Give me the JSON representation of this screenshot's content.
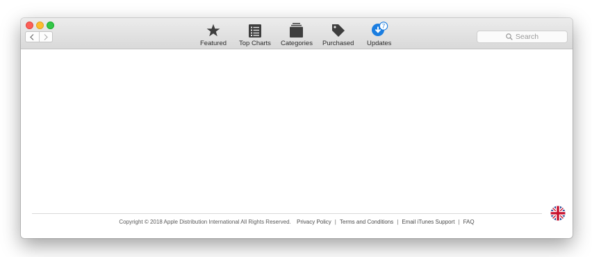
{
  "window": {
    "traffic_lights": [
      "close",
      "minimize",
      "zoom"
    ]
  },
  "toolbar": {
    "nav": {
      "back_icon": "chevron-left-icon",
      "forward_icon": "chevron-right-icon"
    },
    "tabs": [
      {
        "label": "Featured",
        "icon": "star-icon"
      },
      {
        "label": "Top Charts",
        "icon": "list-icon"
      },
      {
        "label": "Categories",
        "icon": "categories-icon"
      },
      {
        "label": "Purchased",
        "icon": "tag-icon"
      },
      {
        "label": "Updates",
        "icon": "updates-icon",
        "badge": "7",
        "color": "#1a7de0"
      }
    ],
    "search": {
      "placeholder": "Search",
      "icon": "search-icon"
    }
  },
  "footer": {
    "copyright": "Copyright © 2018 Apple Distribution International All Rights Reserved.",
    "links": [
      "Privacy Policy",
      "Terms and Conditions",
      "Email iTunes Support",
      "FAQ"
    ],
    "separator": "|",
    "flag_icon": "uk-flag-icon"
  }
}
